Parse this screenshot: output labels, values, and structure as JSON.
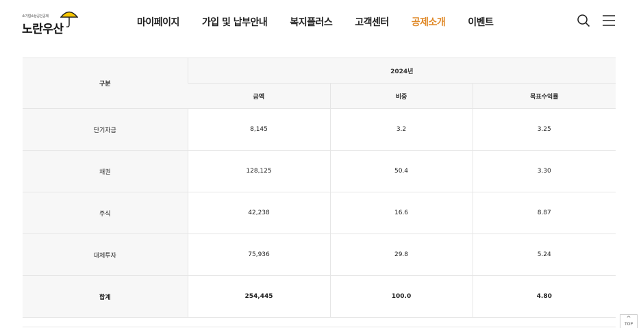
{
  "header": {
    "logo_small": "소기업소상공인공제",
    "logo_main": "노란우산",
    "nav": [
      {
        "label": "마이페이지",
        "active": false
      },
      {
        "label": "가입 및 납부안내",
        "active": false
      },
      {
        "label": "복지플러스",
        "active": false
      },
      {
        "label": "고객센터",
        "active": false
      },
      {
        "label": "공제소개",
        "active": true
      },
      {
        "label": "이벤트",
        "active": false
      }
    ],
    "search_icon": "search-icon",
    "menu_icon": "hamburger-menu-icon",
    "accent_color": "#e08a2a"
  },
  "table": {
    "category_header": "구분",
    "year_header": "2024년",
    "sub_headers": [
      "금액",
      "비중",
      "목표수익률"
    ],
    "rows": [
      {
        "label": "단기자금",
        "amount": "8,145",
        "ratio": "3.2",
        "target": "3.25"
      },
      {
        "label": "채권",
        "amount": "128,125",
        "ratio": "50.4",
        "target": "3.30"
      },
      {
        "label": "주식",
        "amount": "42,238",
        "ratio": "16.6",
        "target": "8.87"
      },
      {
        "label": "대체투자",
        "amount": "75,936",
        "ratio": "29.8",
        "target": "5.24"
      },
      {
        "label": "합계",
        "amount": "254,445",
        "ratio": "100.0",
        "target": "4.80"
      }
    ]
  },
  "top_button": {
    "arrow": "^",
    "label": "TOP"
  }
}
